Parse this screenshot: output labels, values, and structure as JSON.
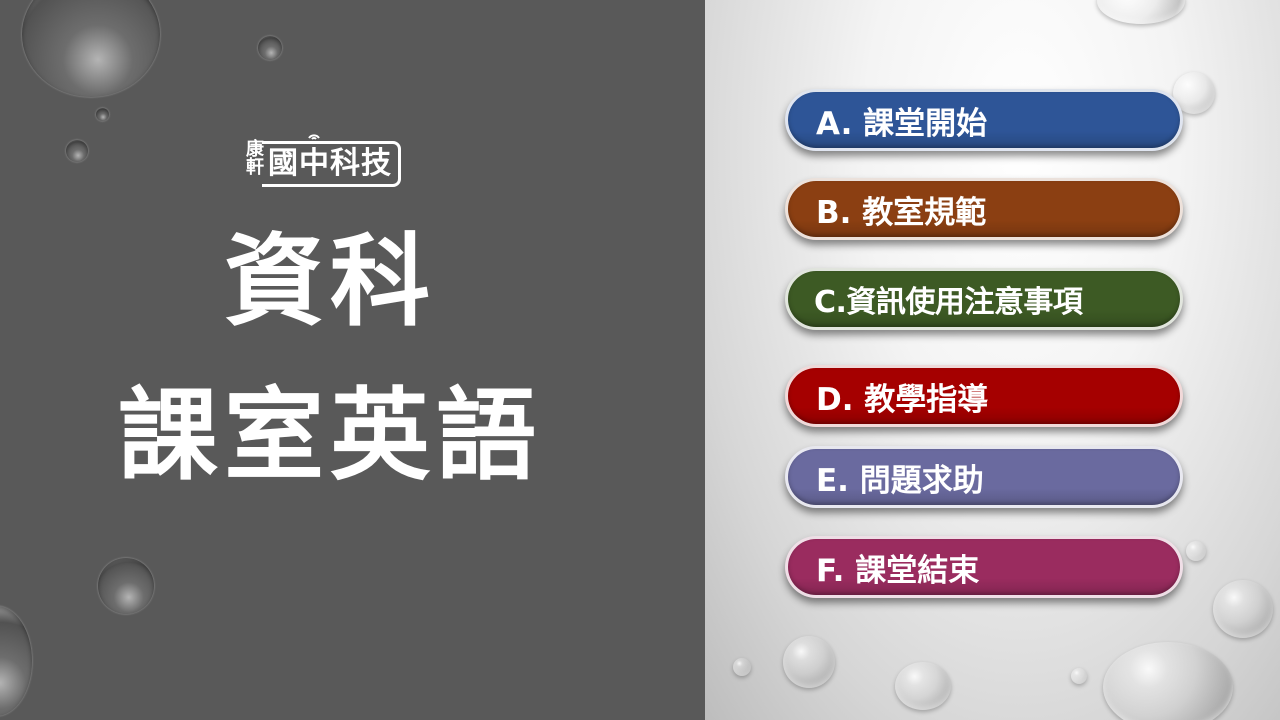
{
  "logo": {
    "small_text": "康軒",
    "main_text": "國中科技"
  },
  "title": {
    "line1": "資科",
    "line2": "課室英語"
  },
  "menu": [
    {
      "label": "A. 課堂開始",
      "color": "#2e5597"
    },
    {
      "label": "B. 教室規範",
      "color": "#8b3f12"
    },
    {
      "label": "C.資訊使用注意事項",
      "color": "#3d5a24"
    },
    {
      "label": "D. 教學指導",
      "color": "#a50000"
    },
    {
      "label": "E. 問題求助",
      "color": "#6a6a9f"
    },
    {
      "label": "F. 課堂結束",
      "color": "#9a2c5f"
    }
  ],
  "colors": {
    "left_panel": "#595959",
    "right_panel": "#f2f2f2",
    "text": "#ffffff"
  }
}
